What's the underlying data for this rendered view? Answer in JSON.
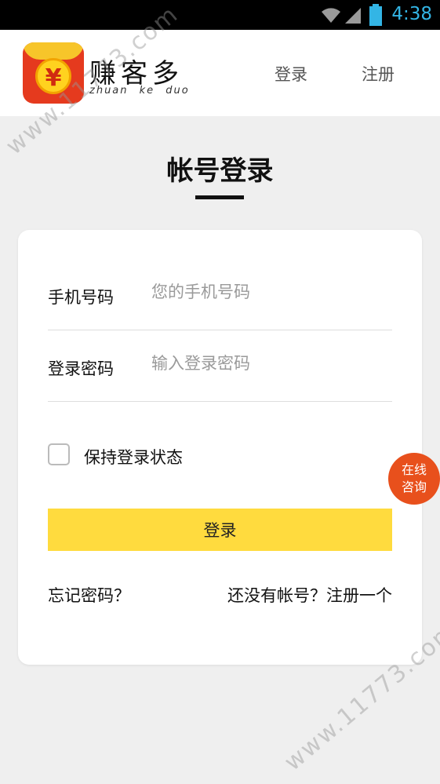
{
  "status_bar": {
    "time": "4:38",
    "icons": [
      "wifi-icon",
      "signal-icon",
      "battery-icon"
    ],
    "color": "#33b5e5"
  },
  "header": {
    "brand_name": "赚客多",
    "brand_pinyin": "zhuan ke duo",
    "logo_symbol": "¥",
    "nav": {
      "login": "登录",
      "register": "注册"
    }
  },
  "page": {
    "title": "帐号登录"
  },
  "form": {
    "phone": {
      "label": "手机号码",
      "placeholder": "您的手机号码",
      "value": ""
    },
    "password": {
      "label": "登录密码",
      "placeholder": "输入登录密码",
      "value": ""
    },
    "remember": {
      "label": "保持登录状态",
      "checked": false
    },
    "submit_label": "登录",
    "forgot_label": "忘记密码？",
    "signup_label": "还没有帐号？注册一个"
  },
  "consult_button": {
    "line1": "在线",
    "line2": "咨询",
    "color": "#e8501c"
  },
  "colors": {
    "accent": "#ffdb3e",
    "background": "#efefef"
  },
  "watermark": "www.11773.com"
}
